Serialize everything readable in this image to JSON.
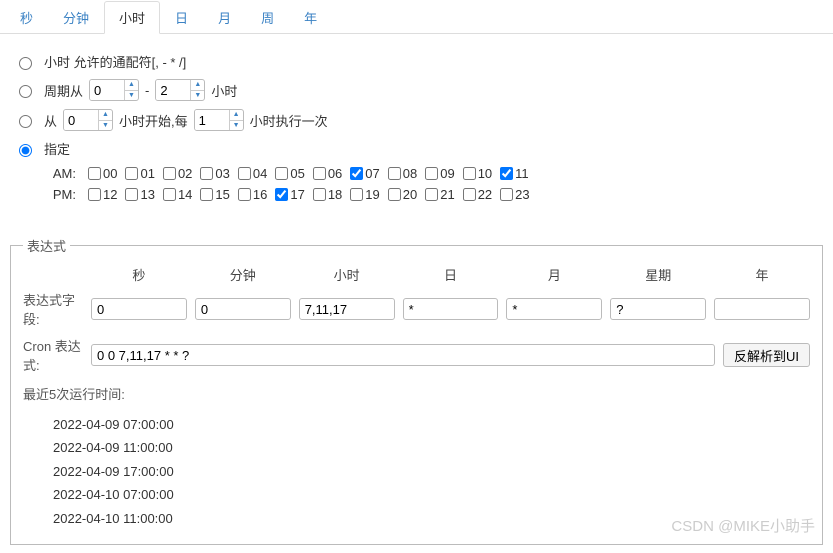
{
  "tabs": {
    "second": "秒",
    "minute": "分钟",
    "hour": "小时",
    "day": "日",
    "month": "月",
    "week": "周",
    "year": "年",
    "active": "hour"
  },
  "hourPanel": {
    "opt1_label": "小时 允许的通配符[, - * /]",
    "opt2_prefix": "周期从",
    "opt2_from": "0",
    "opt2_sep": "-",
    "opt2_to": "2",
    "opt2_suffix": "小时",
    "opt3_prefix": "从",
    "opt3_start": "0",
    "opt3_mid": "小时开始,每",
    "opt3_every": "1",
    "opt3_suffix": "小时执行一次",
    "opt4_label": "指定",
    "selected": "opt4",
    "am_label": "AM:",
    "pm_label": "PM:",
    "am_hours": [
      "00",
      "01",
      "02",
      "03",
      "04",
      "05",
      "06",
      "07",
      "08",
      "09",
      "10",
      "11"
    ],
    "pm_hours": [
      "12",
      "13",
      "14",
      "15",
      "16",
      "17",
      "18",
      "19",
      "20",
      "21",
      "22",
      "23"
    ],
    "checked": [
      "07",
      "11",
      "17"
    ]
  },
  "expr": {
    "legend": "表达式",
    "headers": {
      "second": "秒",
      "minute": "分钟",
      "hour": "小时",
      "day": "日",
      "month": "月",
      "week": "星期",
      "year": "年"
    },
    "fields_label": "表达式字段:",
    "fields": {
      "second": "0",
      "minute": "0",
      "hour": "7,11,17",
      "day": "*",
      "month": "*",
      "week": "?",
      "year": ""
    },
    "cron_label": "Cron 表达式:",
    "cron": "0 0 7,11,17 * * ?",
    "parse_btn": "反解析到UI",
    "recent_label": "最近5次运行时间:",
    "recent": [
      "2022-04-09 07:00:00",
      "2022-04-09 11:00:00",
      "2022-04-09 17:00:00",
      "2022-04-10 07:00:00",
      "2022-04-10 11:00:00"
    ]
  },
  "watermark": "CSDN @MIKE小助手"
}
